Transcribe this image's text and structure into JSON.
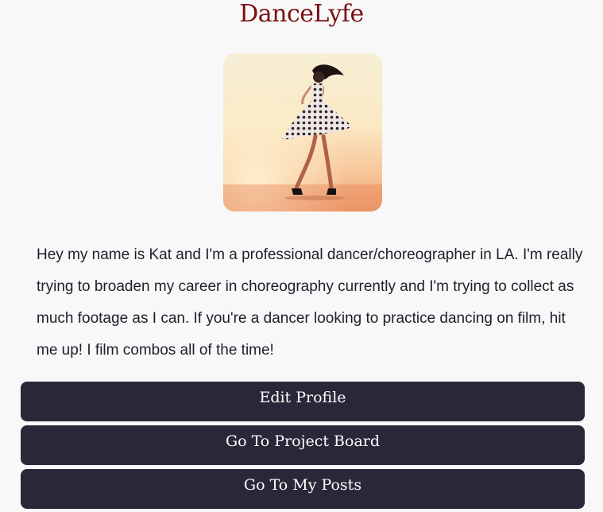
{
  "header": {
    "app_title": "DanceLyfe"
  },
  "profile": {
    "photo_alt": "Dancer twirling in a polka dot dress",
    "bio": "Hey my name is Kat and I'm a professional dancer/choreographer in LA. I'm really trying to broaden my career in choreography currently and I'm trying to collect as much footage as I can. If you're a dancer looking to practice dancing on film, hit me up! I film combos all of the time!"
  },
  "actions": {
    "edit_profile": "Edit Profile",
    "project_board": "Go To Project Board",
    "my_posts": "Go To My Posts"
  },
  "colors": {
    "brand": "#7a0f14",
    "button_bg": "#292838",
    "page_bg": "#f8f8f9"
  }
}
